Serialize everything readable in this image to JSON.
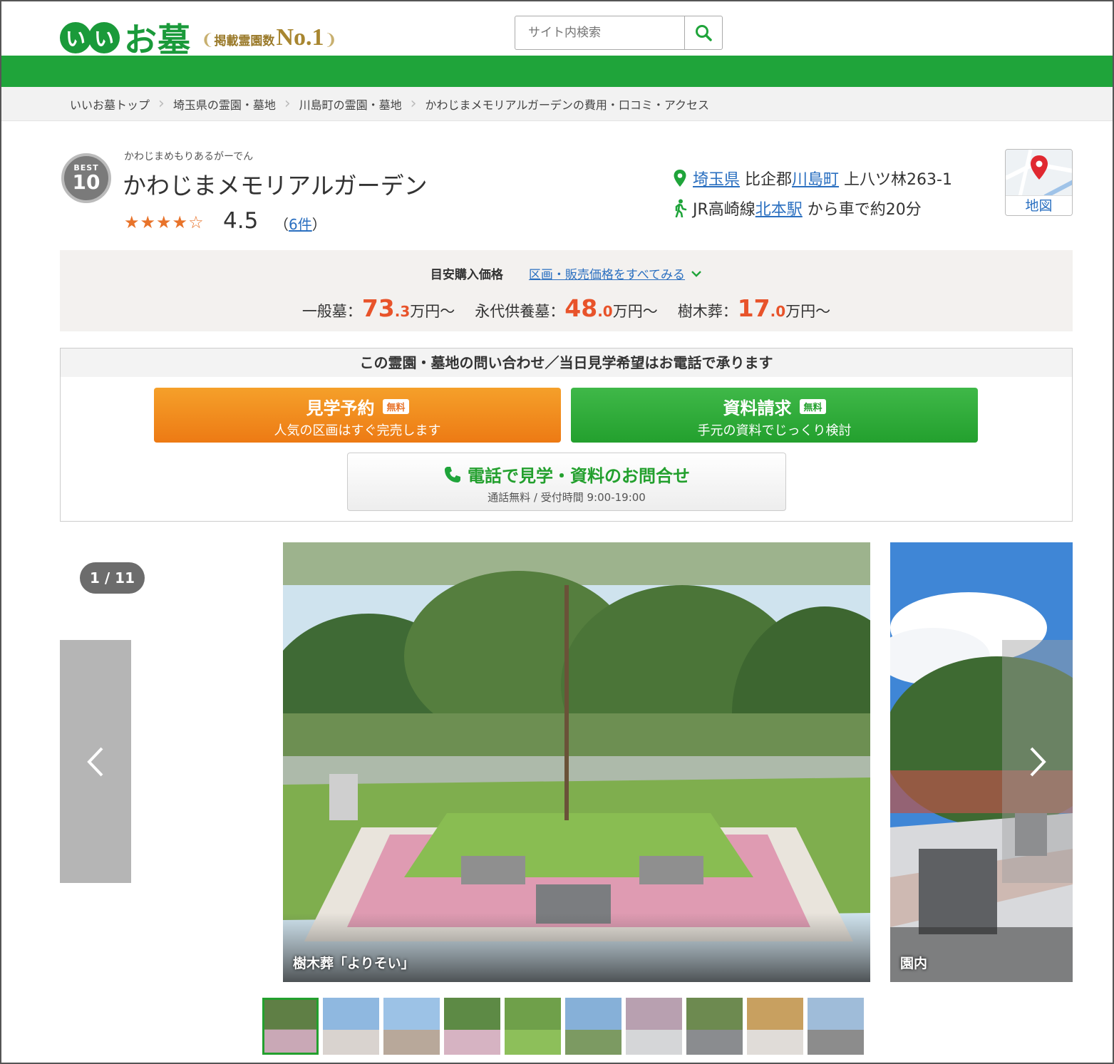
{
  "header": {
    "logo_ii": [
      "い",
      "い"
    ],
    "logo_ohaka": "お墓",
    "logo_badge_text": "掲載霊園数",
    "logo_badge_no1": "No.1",
    "search_placeholder": "サイト内検索"
  },
  "breadcrumb": [
    "いいお墓トップ",
    "埼玉県の霊園・墓地",
    "川島町の霊園・墓地",
    "かわじまメモリアルガーデンの費用・口コミ・アクセス"
  ],
  "cemetery": {
    "best_label": "BEST",
    "best_rank": "10",
    "kana": "かわじまめもりあるがーでん",
    "name": "かわじまメモリアルガーデン",
    "stars": "★★★★☆",
    "rating": "4.5",
    "reviews_open": "（",
    "reviews_count": "6件",
    "reviews_close": "）",
    "address": {
      "prefecture": "埼玉県",
      "district": " 比企郡",
      "town": "川島町",
      "rest": " 上八ツ林263-1"
    },
    "access": {
      "line": "JR高崎線",
      "station": "北本駅",
      "rest": " から車で約20分"
    },
    "map_label": "地図"
  },
  "price": {
    "label": "目安購入価格",
    "link": "区画・販売価格をすべてみる",
    "items": [
      {
        "name": "一般墓：",
        "int": "73",
        "dec": ".3",
        "unit": "万円～"
      },
      {
        "name": "永代供養墓：",
        "int": "48",
        "dec": ".0",
        "unit": "万円～"
      },
      {
        "name": "樹木葬：",
        "int": "17",
        "dec": ".0",
        "unit": "万円～"
      }
    ]
  },
  "contact": {
    "heading": "この霊園・墓地の問い合わせ／当日見学希望はお電話で承ります",
    "tour": {
      "title": "見学予約",
      "badge": "無料",
      "sub": "人気の区画はすぐ完売します"
    },
    "docs": {
      "title": "資料請求",
      "badge": "無料",
      "sub": "手元の資料でじっくり検討"
    },
    "phone": {
      "title": "電話で見学・資料のお問合せ",
      "sub": "通話無料 / 受付時間 9:00-19:00"
    }
  },
  "gallery": {
    "counter": "1 / 11",
    "slides": [
      {
        "caption": "樹木葬「よりそい」"
      },
      {
        "caption": "園内"
      }
    ],
    "thumb_count": 10,
    "active_thumb": 1
  },
  "colors": {
    "brand_green": "#1fa43a",
    "accent_orange": "#e8532a",
    "link_blue": "#2a6fc0"
  }
}
